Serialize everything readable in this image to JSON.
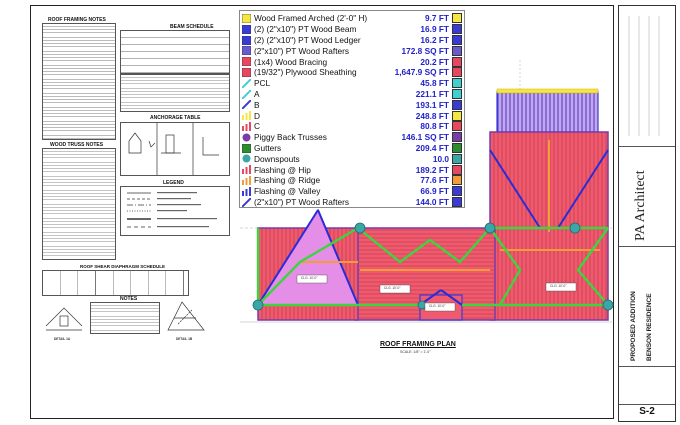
{
  "sheet": {
    "notes_title": "ROOF FRAMING NOTES",
    "schedule_title": "BEAM SCHEDULE",
    "anchorage_title": "ANCHORAGE TABLE",
    "truss_notes_title": "WOOD TRUSS NOTES",
    "legend_title": "LEGEND",
    "diaphragm_title": "ROOF SHEAR DIAPHRAGM SCHEDULE",
    "notes_label": "NOTES",
    "detail_a": "DETAIL 1A",
    "detail_b": "DETAIL 1B",
    "plan_title": "ROOF FRAMING PLAN",
    "plan_scale": "SCALE: 1/8\" = 1'-0\"",
    "clg_labels": [
      "CLG. 10'-0\"",
      "CLG. 10'-0\"",
      "CLG. 10'-0\"",
      "CLG. 10'-0\""
    ]
  },
  "legend": {
    "items": [
      {
        "icon": "arch-icon",
        "label": "Wood Framed Arched (2'-0\" H)",
        "value": "9.7 FT",
        "color": "#f5e642"
      },
      {
        "icon": "beam-icon",
        "label": "(2) (2\"x10\") PT Wood Beam",
        "value": "16.9 FT",
        "color": "#3a3ad6"
      },
      {
        "icon": "ledger-icon",
        "label": "(2) (2\"x10\") PT Wood Ledger",
        "value": "16.2 FT",
        "color": "#3a3ad6"
      },
      {
        "icon": "rafter-block-icon",
        "label": "(2\"x10\") PT Wood Rafters",
        "value": "172.8 SQ FT",
        "color": "#6a5acd"
      },
      {
        "icon": "bracing-icon",
        "label": "(1x4) Wood Bracing",
        "value": "20.2 FT",
        "color": "#e8475f"
      },
      {
        "icon": "sheathing-icon",
        "label": "(19/32\") Plywood Sheathing",
        "value": "1,647.9 SQ FT",
        "color": "#e8475f"
      },
      {
        "icon": "pcl-icon",
        "label": "PCL",
        "value": "45.8 FT",
        "color": "#3fd0d0"
      },
      {
        "icon": "line-a-icon",
        "label": "A",
        "value": "221.1 FT",
        "color": "#3fd0d0"
      },
      {
        "icon": "line-b-icon",
        "label": "B",
        "value": "193.1 FT",
        "color": "#3a3ad6"
      },
      {
        "icon": "bar-d-icon",
        "label": "D",
        "value": "248.8 FT",
        "color": "#f5e642"
      },
      {
        "icon": "bar-c-icon",
        "label": "C",
        "value": "80.8 FT",
        "color": "#e8475f"
      },
      {
        "icon": "truss-icon",
        "label": "Piggy Back Trusses",
        "value": "146.1 SQ FT",
        "color": "#7a3aa8"
      },
      {
        "icon": "gutter-icon",
        "label": "Gutters",
        "value": "209.4 FT",
        "color": "#2e8b2e"
      },
      {
        "icon": "downspout-icon",
        "label": "Downspouts",
        "value": "10.0",
        "color": "#3aa6a6"
      },
      {
        "icon": "flashing-hip-icon",
        "label": "Flashing @ Hip",
        "value": "189.2 FT",
        "color": "#e8475f"
      },
      {
        "icon": "flashing-ridge-icon",
        "label": "Flashing @ Ridge",
        "value": "77.6 FT",
        "color": "#f39c3a"
      },
      {
        "icon": "flashing-valley-icon",
        "label": "Flashing @ Valley",
        "value": "66.9 FT",
        "color": "#3a3ad6"
      },
      {
        "icon": "rafter-line-icon",
        "label": "(2\"x10\") PT Wood Rafters",
        "value": "144.0 FT",
        "color": "#3a3ad6"
      }
    ]
  },
  "title_block": {
    "firm": "PA Architect",
    "project_type": "PROPOSED ADDITION",
    "project_name": "BENSON RESIDENCE",
    "sheet_number": "S-2"
  }
}
